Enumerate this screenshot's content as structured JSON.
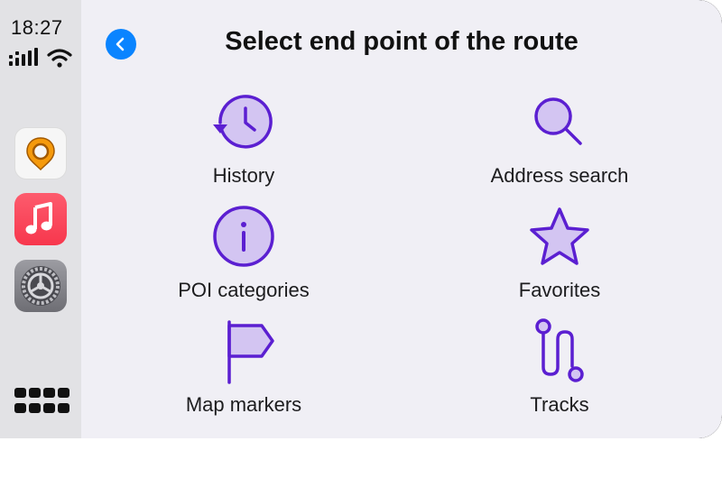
{
  "status_bar": {
    "time": "18:27"
  },
  "sidebar": {
    "apps": [
      {
        "name": "OsmAnd",
        "icon": "osmand-icon"
      },
      {
        "name": "Music",
        "icon": "music-note-icon"
      },
      {
        "name": "Settings",
        "icon": "gear-icon"
      }
    ],
    "app_grid_icon": "grid-icon"
  },
  "header": {
    "title": "Select end point of the route",
    "back_icon": "chevron-left-icon"
  },
  "options": [
    {
      "label": "History",
      "icon": "history-clock-icon"
    },
    {
      "label": "Address search",
      "icon": "search-icon"
    },
    {
      "label": "POI categories",
      "icon": "info-icon"
    },
    {
      "label": "Favorites",
      "icon": "star-icon"
    },
    {
      "label": "Map markers",
      "icon": "flag-icon"
    },
    {
      "label": "Tracks",
      "icon": "track-route-icon"
    }
  ],
  "colors": {
    "accent": "#5b1fd1",
    "accent_fill": "#d3c5f2",
    "back_button": "#0a84ff",
    "background": "#f0eff5",
    "sidebar": "#e2e2e5"
  }
}
